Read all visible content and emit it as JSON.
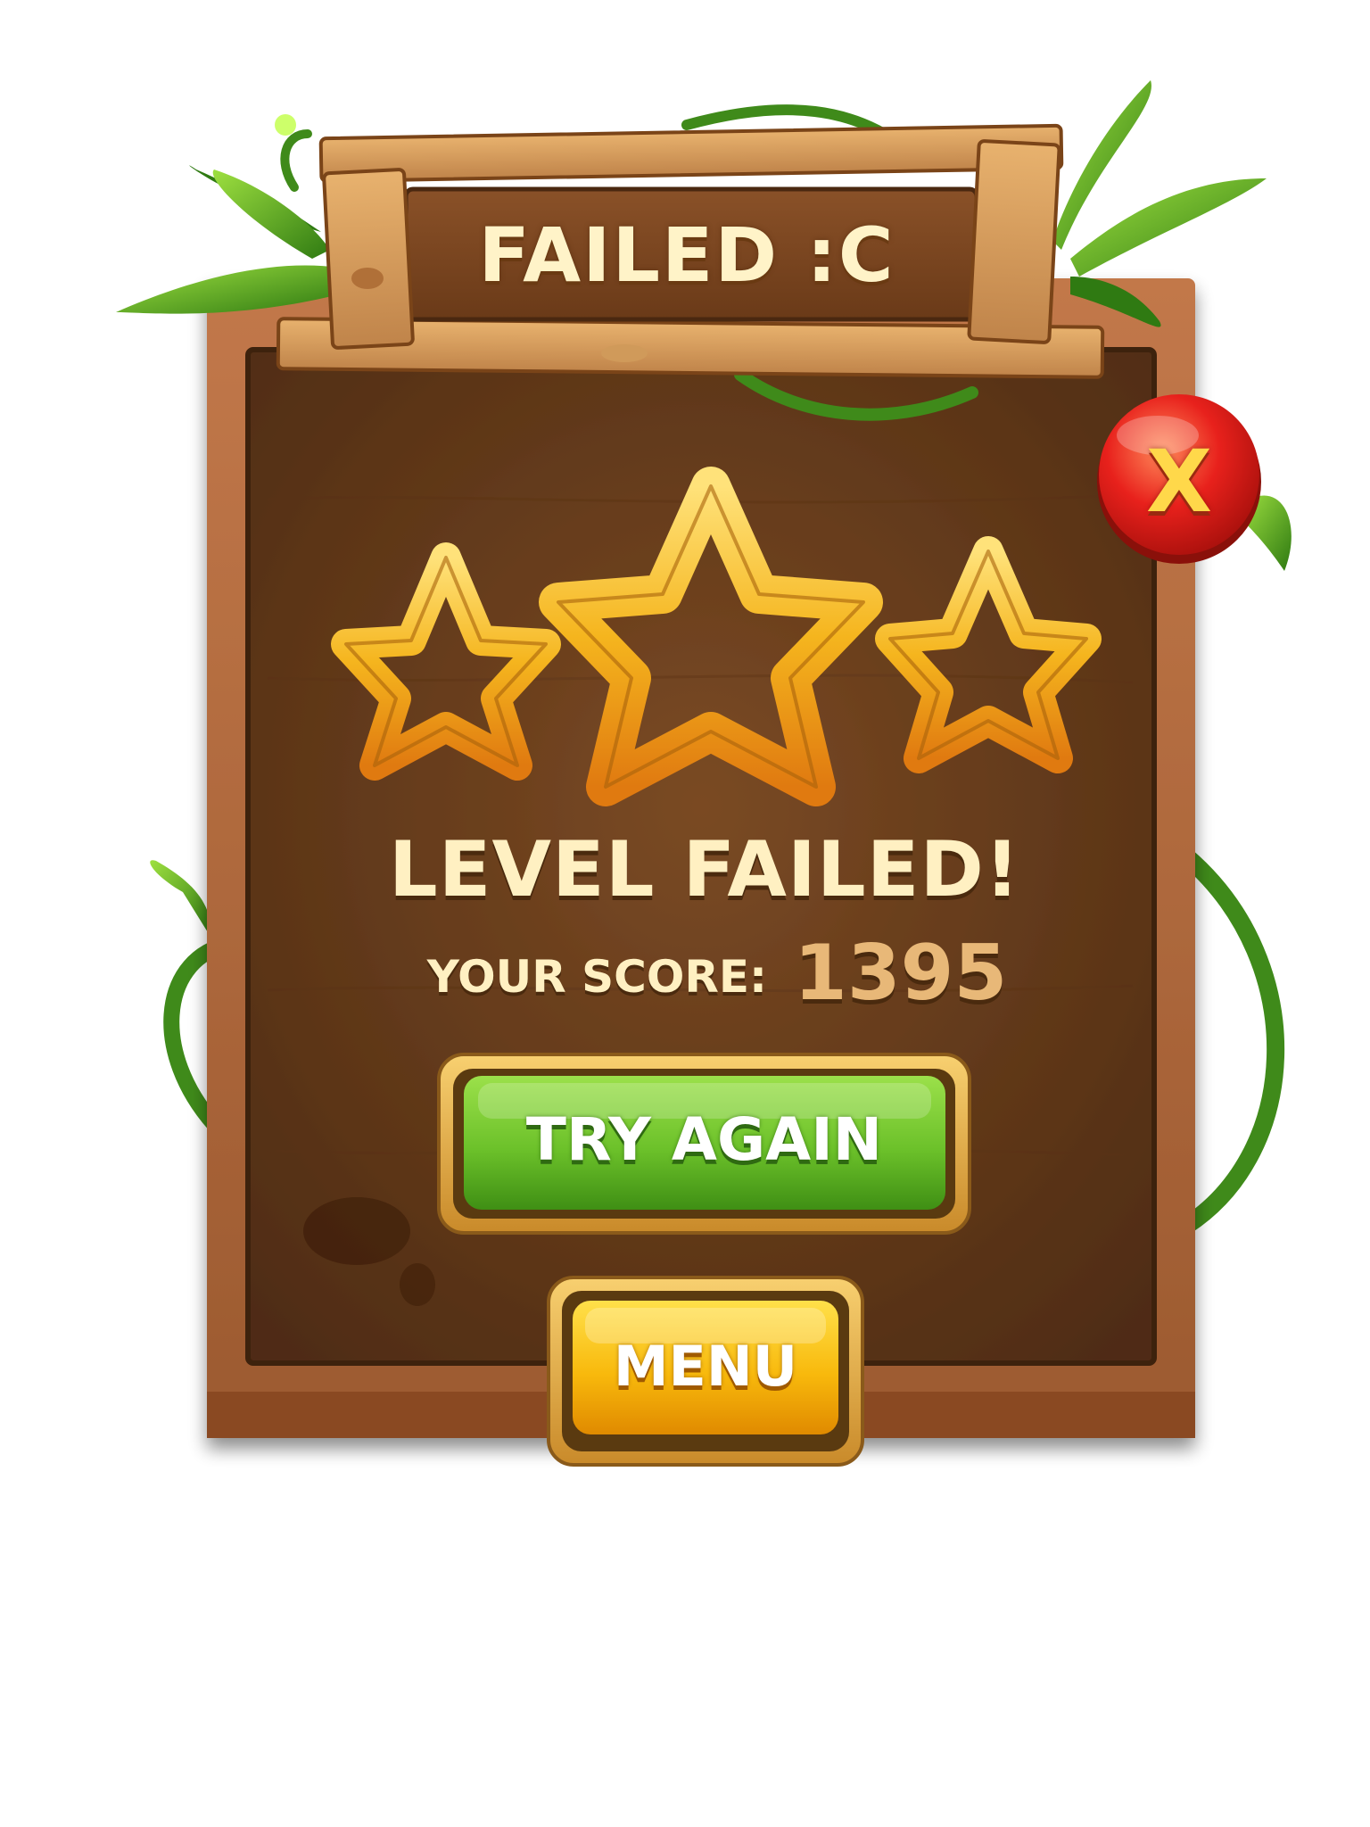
{
  "popup": {
    "title": "FAILED :C",
    "headline": "LEVEL FAILED!",
    "score_label": "YOUR SCORE:",
    "score_value": "1395",
    "stars_earned": 0,
    "stars_total": 3
  },
  "buttons": {
    "try_again_label": "TRY AGAIN",
    "menu_label": "MENU",
    "close_glyph": "X"
  },
  "colors": {
    "wood_frame": "#b0683a",
    "wood_panel": "#6b3f1e",
    "star_gold": "#f5b51e",
    "try_again_green": "#6cc12a",
    "menu_yellow": "#f8b90c",
    "close_red": "#e8211c",
    "leaf_green": "#3f9a1c"
  },
  "icons": {
    "close": "close-icon",
    "star": "star-icon",
    "leaf": "leaf-icon",
    "vine": "vine-icon"
  }
}
